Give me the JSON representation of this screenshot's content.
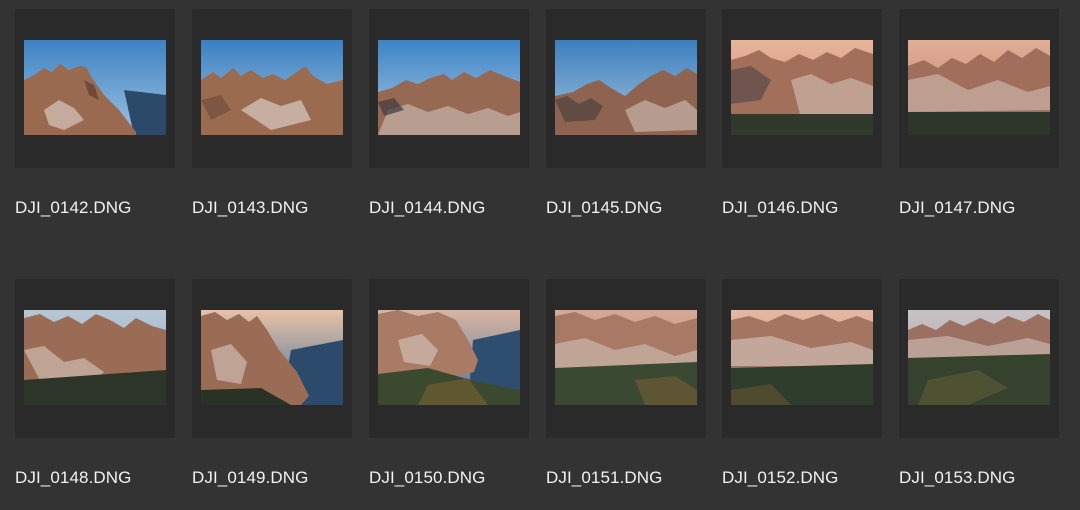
{
  "files": [
    {
      "name": "DJI_0142.DNG",
      "thumbnail": "mountain-photo"
    },
    {
      "name": "DJI_0143.DNG",
      "thumbnail": "mountain-photo"
    },
    {
      "name": "DJI_0144.DNG",
      "thumbnail": "mountain-photo"
    },
    {
      "name": "DJI_0145.DNG",
      "thumbnail": "mountain-photo"
    },
    {
      "name": "DJI_0146.DNG",
      "thumbnail": "mountain-photo"
    },
    {
      "name": "DJI_0147.DNG",
      "thumbnail": "mountain-photo"
    },
    {
      "name": "DJI_0148.DNG",
      "thumbnail": "mountain-photo"
    },
    {
      "name": "DJI_0149.DNG",
      "thumbnail": "mountain-photo"
    },
    {
      "name": "DJI_0150.DNG",
      "thumbnail": "mountain-photo"
    },
    {
      "name": "DJI_0151.DNG",
      "thumbnail": "mountain-photo"
    },
    {
      "name": "DJI_0152.DNG",
      "thumbnail": "mountain-photo"
    },
    {
      "name": "DJI_0153.DNG",
      "thumbnail": "mountain-photo"
    }
  ],
  "colors": {
    "background": "#333333",
    "tile": "#2a2a2a",
    "label": "#f2f2f2"
  }
}
